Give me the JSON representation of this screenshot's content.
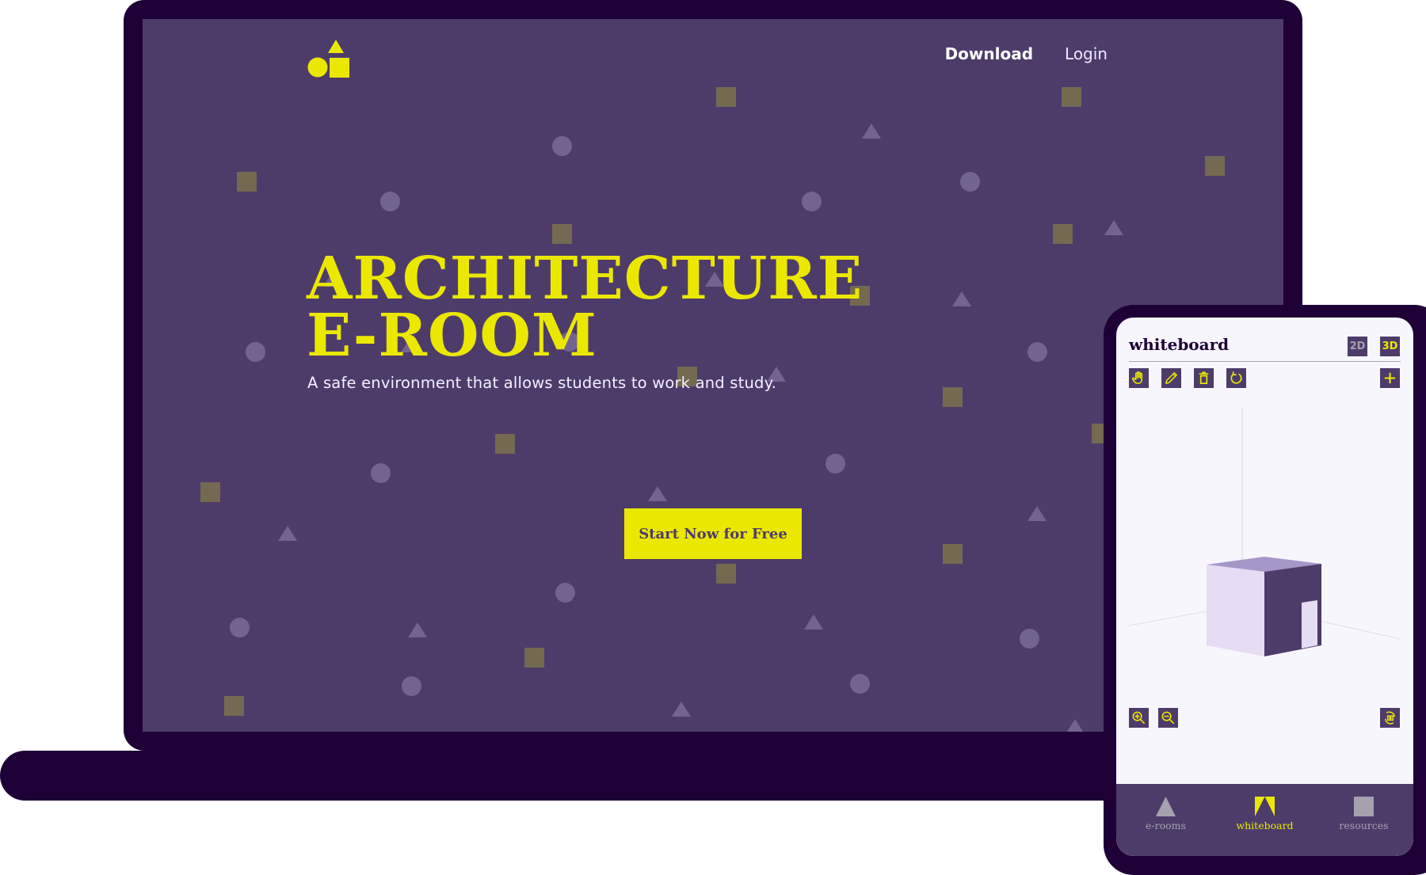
{
  "colors": {
    "frame": "#1e0036",
    "screen_bg": "#4d3c6a",
    "accent_yellow": "#ebe800",
    "shape_square": "#736a51",
    "shape_light": "#736390",
    "phone_bg": "#f8f6fd",
    "inactive_gray": "#a5a1ae"
  },
  "landing": {
    "logo": "circle-triangle-square-logo",
    "nav": {
      "download_label": "Download",
      "login_label": "Login"
    },
    "hero": {
      "title_line1": "ARCHITECTURE",
      "title_line2": "E-ROOM",
      "subtitle": "A safe environment that allows students to work and study."
    },
    "cta_label": "Start Now for Free"
  },
  "phone": {
    "title": "whiteboard",
    "view_toggle": {
      "options": [
        "2D",
        "3D"
      ],
      "selected": "3D"
    },
    "toolbar": [
      {
        "icon": "hand-icon",
        "label": "Pan"
      },
      {
        "icon": "pencil-icon",
        "label": "Draw"
      },
      {
        "icon": "trash-icon",
        "label": "Delete"
      },
      {
        "icon": "refresh-icon",
        "label": "Reset"
      }
    ],
    "add_icon": "plus-icon",
    "zoom_controls": [
      {
        "icon": "zoom-in-icon"
      },
      {
        "icon": "zoom-out-icon"
      }
    ],
    "rotate_camera_icon": "rotate-camera-icon",
    "bottom_nav": {
      "items": [
        {
          "label": "e-rooms",
          "icon": "triangle-icon",
          "active": false
        },
        {
          "label": "whiteboard",
          "icon": "whiteboard-icon",
          "active": true
        },
        {
          "label": "resources",
          "icon": "square-icon",
          "active": false
        }
      ]
    }
  }
}
